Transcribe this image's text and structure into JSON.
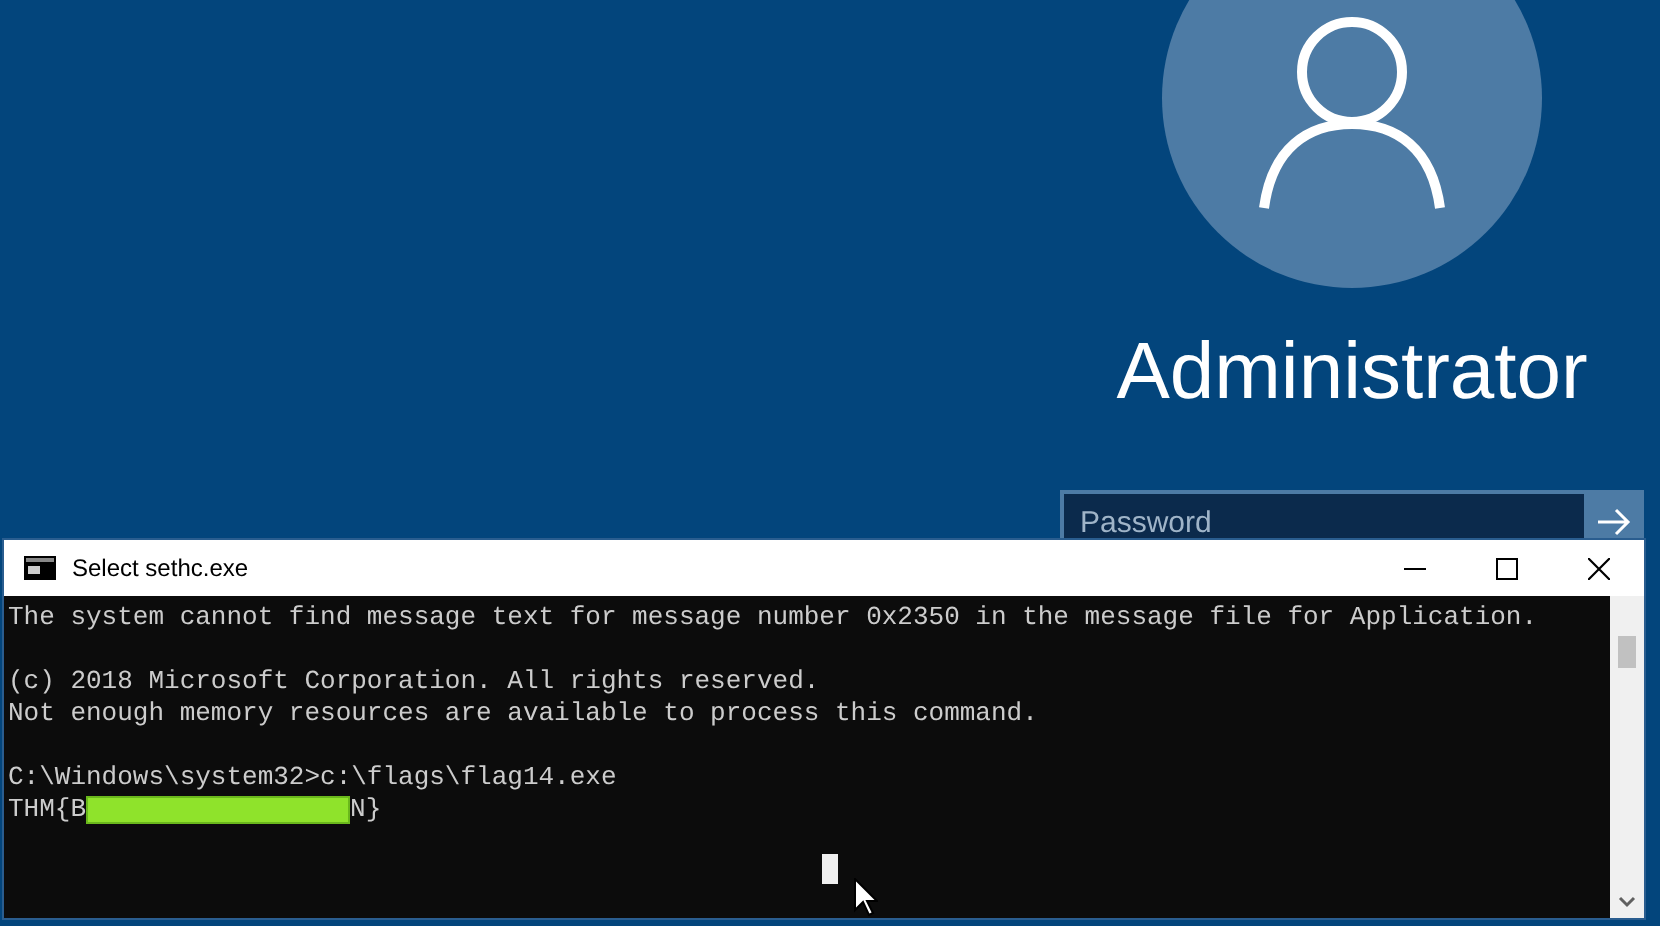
{
  "lock_screen": {
    "user_name": "Administrator",
    "password_placeholder": "Password"
  },
  "console": {
    "title": "Select sethc.exe",
    "blocks": [
      {
        "lines": [
          "The system cannot find message text for message number 0x2350 in the message file for Application."
        ]
      },
      {
        "lines": [
          "(c) 2018 Microsoft Corporation. All rights reserved.",
          "Not enough memory resources are available to process this command."
        ]
      },
      {
        "lines": [
          "C:\\Windows\\system32>c:\\flags\\flag14.exe"
        ]
      }
    ],
    "flag_prefix": "THM{B",
    "flag_suffix": "N}"
  }
}
